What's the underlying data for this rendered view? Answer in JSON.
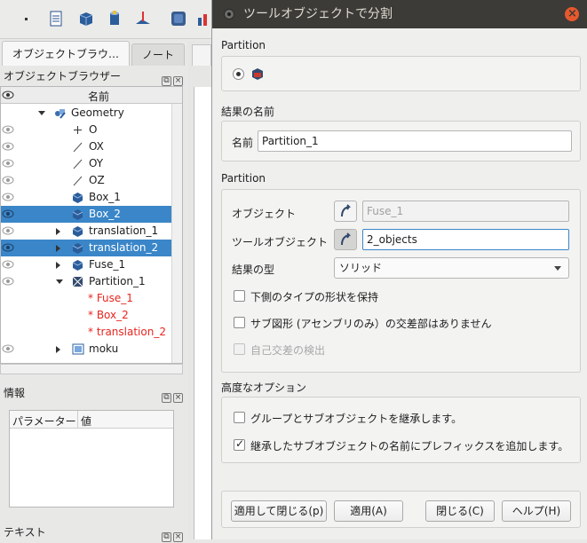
{
  "left_panel": {
    "tabs": [
      {
        "label": "オブジェクトブラウ…",
        "active": true
      },
      {
        "label": "ノート",
        "active": false
      }
    ],
    "object_browser_title": "オブジェクトブラウザー",
    "column_name": "名前",
    "tree": [
      {
        "label": "Geometry",
        "icon": "geometry-icon",
        "indent": 0,
        "arrow": "down",
        "eye": false,
        "selected": false,
        "red": false
      },
      {
        "label": "O",
        "icon": "point-icon",
        "indent": 1,
        "arrow": "",
        "eye": true,
        "selected": false,
        "red": false
      },
      {
        "label": "OX",
        "icon": "vector-icon",
        "indent": 1,
        "arrow": "",
        "eye": true,
        "selected": false,
        "red": false
      },
      {
        "label": "OY",
        "icon": "vector-icon",
        "indent": 1,
        "arrow": "",
        "eye": true,
        "selected": false,
        "red": false
      },
      {
        "label": "OZ",
        "icon": "vector-icon",
        "indent": 1,
        "arrow": "",
        "eye": true,
        "selected": false,
        "red": false
      },
      {
        "label": "Box_1",
        "icon": "box-icon",
        "indent": 1,
        "arrow": "",
        "eye": true,
        "selected": false,
        "red": false
      },
      {
        "label": "Box_2",
        "icon": "box-icon",
        "indent": 1,
        "arrow": "",
        "eye": true,
        "selected": true,
        "red": false
      },
      {
        "label": "translation_1",
        "icon": "box-icon",
        "indent": 1,
        "arrow": "right",
        "eye": true,
        "selected": false,
        "red": false
      },
      {
        "label": "translation_2",
        "icon": "box-icon",
        "indent": 1,
        "arrow": "right",
        "eye": true,
        "selected": true,
        "red": false
      },
      {
        "label": "Fuse_1",
        "icon": "box-icon",
        "indent": 1,
        "arrow": "right",
        "eye": true,
        "selected": false,
        "red": false
      },
      {
        "label": "Partition_1",
        "icon": "partition-icon",
        "indent": 1,
        "arrow": "down",
        "eye": true,
        "selected": false,
        "red": false
      },
      {
        "label": "* Fuse_1",
        "icon": "",
        "indent": 2,
        "arrow": "",
        "eye": false,
        "selected": false,
        "red": true
      },
      {
        "label": "* Box_2",
        "icon": "",
        "indent": 2,
        "arrow": "",
        "eye": false,
        "selected": false,
        "red": true
      },
      {
        "label": "* translation_2",
        "icon": "",
        "indent": 2,
        "arrow": "",
        "eye": false,
        "selected": false,
        "red": true
      },
      {
        "label": "moku",
        "icon": "group-icon",
        "indent": 1,
        "arrow": "right",
        "eye": true,
        "selected": false,
        "red": false
      }
    ],
    "info_title": "情報",
    "info_columns": [
      "パラメーター",
      "値"
    ],
    "text_title": "テキスト"
  },
  "dialog": {
    "title": "ツールオブジェクトで分割",
    "section_partition_top": "Partition",
    "section_result_name": "結果の名前",
    "name_label": "名前",
    "name_value": "Partition_1",
    "section_partition": "Partition",
    "objects_label": "オブジェクト",
    "objects_value": "Fuse_1",
    "tool_objects_label": "ツールオブジェクト",
    "tool_objects_value": "2_objects",
    "result_type_label": "結果の型",
    "result_type_value": "ソリッド",
    "keep_shapes_label": "下側のタイプの形状を保持",
    "no_intersection_label": "サブ図形 (アセンブリのみ）の交差部はありません",
    "self_intersection_label": "自己交差の検出",
    "section_advanced": "高度なオプション",
    "inherit_label": "グループとサブオブジェクトを継承します。",
    "prefix_label": "継承したサブオブジェクトの名前にプレフィックスを追加します。",
    "buttons": {
      "apply_close": "適用して閉じる(p)",
      "apply": "適用(A)",
      "close": "閉じる(C)",
      "help": "ヘルプ(H)"
    }
  }
}
